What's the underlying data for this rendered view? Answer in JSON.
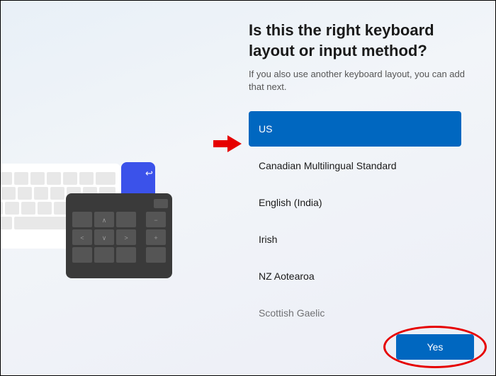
{
  "title": "Is this the right keyboard layout or input method?",
  "subtitle": "If you also use another keyboard layout, you can add that next.",
  "selected_index": 0,
  "options": [
    {
      "label": "US"
    },
    {
      "label": "Canadian Multilingual Standard"
    },
    {
      "label": "English (India)"
    },
    {
      "label": "Irish"
    },
    {
      "label": "NZ Aotearoa"
    },
    {
      "label": "Scottish Gaelic"
    }
  ],
  "yes_label": "Yes",
  "colors": {
    "accent": "#0067c0",
    "annotation": "#e60000"
  }
}
